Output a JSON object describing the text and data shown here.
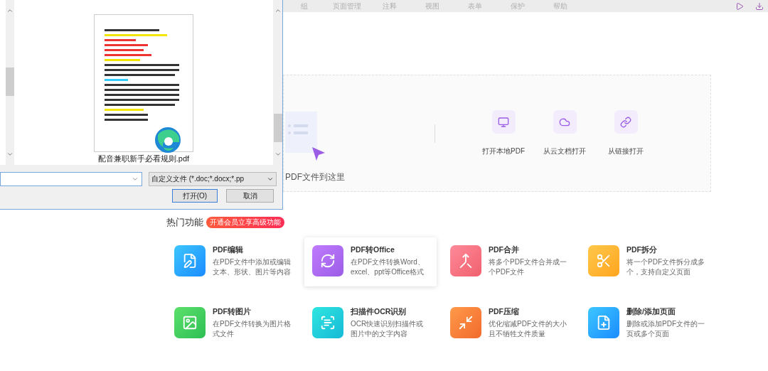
{
  "menu": [
    "组",
    "页面管理",
    "注释",
    "视图",
    "表单",
    "保护",
    "帮助"
  ],
  "dialog": {
    "file_name": "配音兼职新手必看规则.pdf",
    "file_type": "自定义文件 (*.doc;*.docx;*.pp",
    "buttons": [
      "打开(O)",
      "取消"
    ]
  },
  "drop_zone": {
    "hint": "PDF文件到这里",
    "options": [
      "打开本地PDF",
      "从云文档打开",
      "从链接打开"
    ]
  },
  "hot": {
    "title": "热门功能",
    "badge": "开通会员立享高级功能"
  },
  "features": [
    {
      "title": "PDF编辑",
      "desc": "在PDF文件中添加或编辑文本、形状、图片等内容",
      "selected": false
    },
    {
      "title": "PDF转Office",
      "desc": "在PDF文件转换Word、excel、ppt等Office格式",
      "selected": true
    },
    {
      "title": "PDF合并",
      "desc": "将多个PDF文件合并成一个PDF文件",
      "selected": false
    },
    {
      "title": "PDF拆分",
      "desc": "将一个PDF文件拆分成多个，支持自定义页面",
      "selected": false
    },
    {
      "title": "PDF转图片",
      "desc": "在PDF文件转换为图片格式文件",
      "selected": false
    },
    {
      "title": "扫描件OCR识别",
      "desc": "OCR快速识别扫描件或图片中的文字内容",
      "selected": false
    },
    {
      "title": "PDF压缩",
      "desc": "优化缩减PDF文件的大小且不牺牲文件质量",
      "selected": false
    },
    {
      "title": "删除/添加页面",
      "desc": "删除或添加PDF文件的一页或多个页面",
      "selected": false
    }
  ]
}
